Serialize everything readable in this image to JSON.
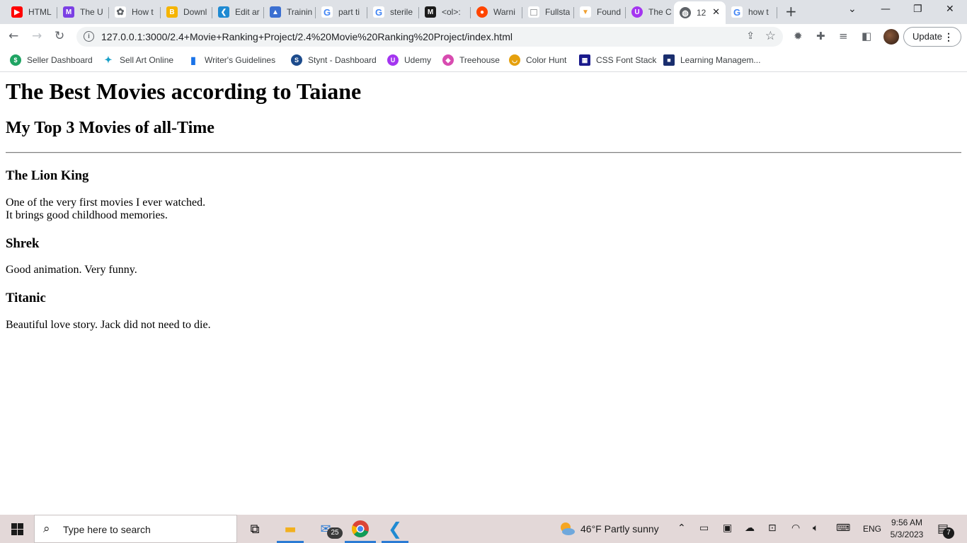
{
  "browser": {
    "tabs": [
      {
        "label": "HTML",
        "icon": "youtube-icon",
        "color": "#ff0000",
        "glyph": "▶"
      },
      {
        "label": "The U",
        "icon": "m-logo-icon",
        "color": "#7b3fe4",
        "glyph": "M"
      },
      {
        "label": "How t",
        "icon": "gear-icon",
        "color": "#5f6368",
        "glyph": "✿"
      },
      {
        "label": "Downl",
        "icon": "bitcoin-icon",
        "color": "#f5b400",
        "glyph": "B"
      },
      {
        "label": "Edit ar",
        "icon": "vscode-icon",
        "color": "#1f8ad2",
        "glyph": "❮"
      },
      {
        "label": "Trainin",
        "icon": "graduation-cap-icon",
        "color": "#3b6fd1",
        "glyph": "▲"
      },
      {
        "label": "part ti",
        "icon": "google-icon",
        "color": "#4285f4",
        "glyph": "G"
      },
      {
        "label": "sterile",
        "icon": "google-icon",
        "color": "#4285f4",
        "glyph": "G"
      },
      {
        "label": "<ol>:",
        "icon": "mdn-icon",
        "color": "#1b1b1b",
        "glyph": "M"
      },
      {
        "label": "Warni",
        "icon": "reddit-icon",
        "color": "#ff4500",
        "glyph": "●"
      },
      {
        "label": "Fullsta",
        "icon": "square-icon",
        "color": "#5f6368",
        "glyph": "□"
      },
      {
        "label": "Found",
        "icon": "fox-icon",
        "color": "#f0a030",
        "glyph": "▼"
      },
      {
        "label": "The C",
        "icon": "udemy-icon",
        "color": "#a435f0",
        "glyph": "U"
      },
      {
        "label": "12",
        "icon": "globe-icon",
        "color": "#5f6368",
        "glyph": "◍",
        "active": true
      },
      {
        "label": "how t",
        "icon": "google-icon",
        "color": "#4285f4",
        "glyph": "G"
      }
    ],
    "url": "127.0.0.1:3000/2.4+Movie+Ranking+Project/2.4%20Movie%20Ranking%20Project/index.html",
    "update_label": "Update",
    "bookmarks": [
      {
        "label": "Seller Dashboard",
        "color": "#1fa463",
        "glyph": "$"
      },
      {
        "label": "Sell Art Online",
        "color": "#19a0c8",
        "glyph": "✦"
      },
      {
        "label": "Writer's Guidelines",
        "color": "#1a73e8",
        "glyph": "▮"
      },
      {
        "label": "Stynt - Dashboard",
        "color": "#1c4b8c",
        "glyph": "S"
      },
      {
        "label": "Udemy",
        "color": "#a435f0",
        "glyph": "U"
      },
      {
        "label": "Treehouse",
        "color": "#d84bb0",
        "glyph": "◆"
      },
      {
        "label": "Color Hunt",
        "color": "#e5a00d",
        "glyph": "◡"
      },
      {
        "label": "CSS Font Stack",
        "color": "#1a1a8c",
        "glyph": "▦"
      },
      {
        "label": "Learning Managem...",
        "color": "#1a2e6e",
        "glyph": "■"
      }
    ]
  },
  "page": {
    "title": "The Best Movies according to Taiane",
    "subtitle": "My Top 3 Movies of all-Time",
    "movies": [
      {
        "name": "The Lion King",
        "lines": [
          "One of the very first movies I ever watched.",
          "It brings good childhood memories."
        ]
      },
      {
        "name": "Shrek",
        "lines": [
          "Good animation. Very funny."
        ]
      },
      {
        "name": "Titanic",
        "lines": [
          "Beautiful love story. Jack did not need to die."
        ]
      }
    ]
  },
  "taskbar": {
    "search_placeholder": "Type here to search",
    "mail_badge": "25",
    "weather": "46°F  Partly sunny",
    "language": "ENG",
    "time": "9:56 AM",
    "date": "5/3/2023",
    "notification_count": "7"
  }
}
